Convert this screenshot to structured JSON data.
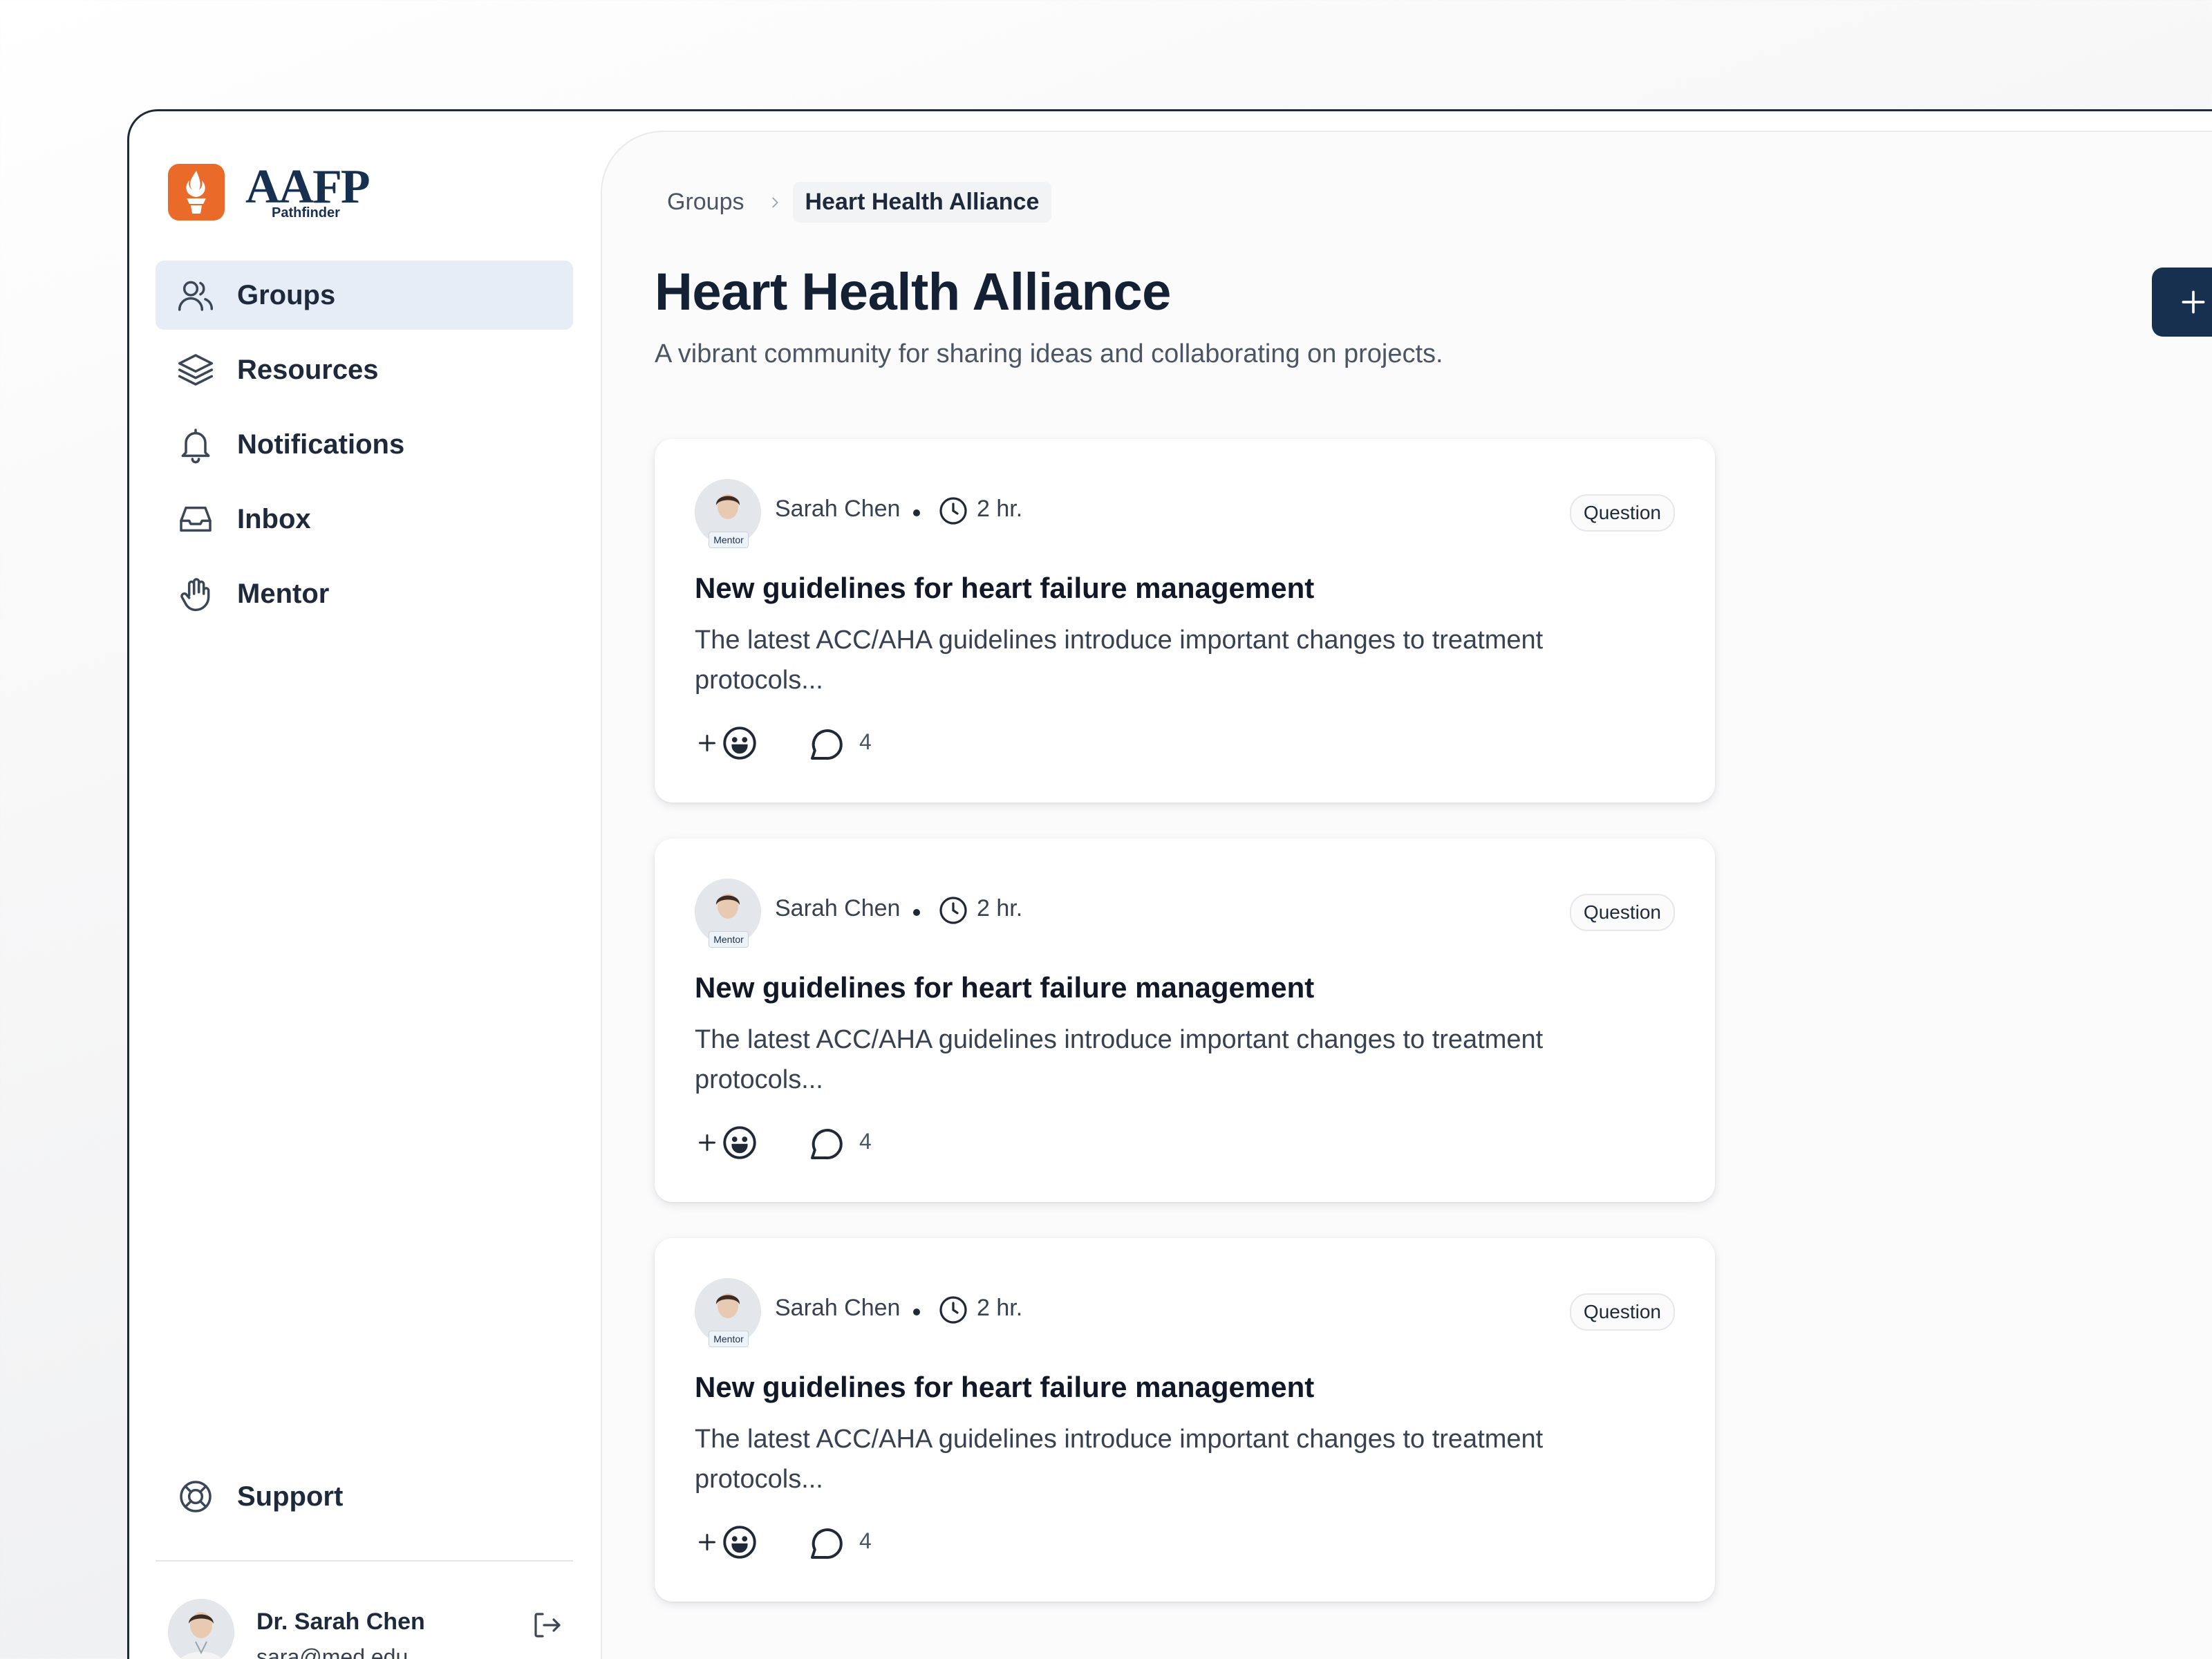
{
  "brand": {
    "name": "AAFP",
    "sub": "Pathfinder"
  },
  "nav": {
    "items": [
      {
        "label": "Groups",
        "icon": "users-icon",
        "active": true
      },
      {
        "label": "Resources",
        "icon": "layers-icon"
      },
      {
        "label": "Notifications",
        "icon": "bell-icon"
      },
      {
        "label": "Inbox",
        "icon": "inbox-icon"
      },
      {
        "label": "Mentor",
        "icon": "hand-icon"
      }
    ],
    "support": {
      "label": "Support",
      "icon": "lifebuoy-icon"
    }
  },
  "user": {
    "name": "Dr. Sarah Chen",
    "email": "sara@med.edu"
  },
  "breadcrumb": {
    "parent": "Groups",
    "current": "Heart Health Alliance"
  },
  "page": {
    "title": "Heart Health Alliance",
    "description": "A vibrant community for sharing ideas and collaborating on projects."
  },
  "posts": [
    {
      "author": "Sarah Chen",
      "badge": "Mentor",
      "time": "2 hr.",
      "tag": "Question",
      "title": "New guidelines for heart failure management",
      "body": "The latest ACC/AHA guidelines introduce important changes to treatment protocols...",
      "react_plus": "+",
      "comments": "4"
    },
    {
      "author": "Sarah Chen",
      "badge": "Mentor",
      "time": "2 hr.",
      "tag": "Question",
      "title": "New guidelines for heart failure management",
      "body": "The latest ACC/AHA guidelines introduce important changes to treatment protocols...",
      "react_plus": "+",
      "comments": "4"
    },
    {
      "author": "Sarah Chen",
      "badge": "Mentor",
      "time": "2 hr.",
      "tag": "Question",
      "title": "New guidelines for heart failure management",
      "body": "The latest ACC/AHA guidelines introduce important changes to treatment protocols...",
      "react_plus": "+",
      "comments": "4"
    }
  ],
  "colors": {
    "brand_orange": "#ea6a2a",
    "navy": "#17304f",
    "active_nav_bg": "#e6edf6"
  }
}
